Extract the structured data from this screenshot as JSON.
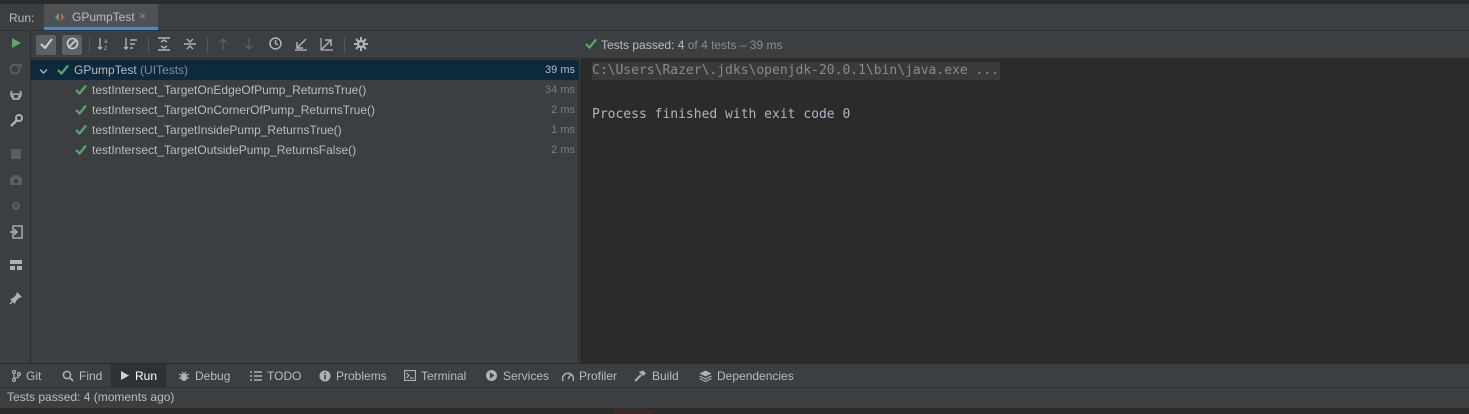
{
  "run_panel": {
    "label": "Run:",
    "tab_title": "GPumpTest",
    "tab_close": "×"
  },
  "status": {
    "prefix": "Tests passed:",
    "passed": "4",
    "suffix": "of 4 tests – 39 ms"
  },
  "tree": {
    "root": {
      "name": "GPumpTest",
      "suite": "(UITests)",
      "duration": "39 ms"
    },
    "tests": [
      {
        "name": "testIntersect_TargetOnEdgeOfPump_ReturnsTrue()",
        "duration": "34 ms"
      },
      {
        "name": "testIntersect_TargetOnCornerOfPump_ReturnsTrue()",
        "duration": "2 ms"
      },
      {
        "name": "testIntersect_TargetInsidePump_ReturnsTrue()",
        "duration": "1 ms"
      },
      {
        "name": "testIntersect_TargetOutsidePump_ReturnsFalse()",
        "duration": "2 ms"
      }
    ]
  },
  "console": {
    "command": "C:\\Users\\Razer\\.jdks\\openjdk-20.0.1\\bin\\java.exe ...",
    "output": "Process finished with exit code 0"
  },
  "bottom_tabs": [
    {
      "label": "Git",
      "icon": "git-branch-icon"
    },
    {
      "label": "Find",
      "icon": "search-icon"
    },
    {
      "label": "Run",
      "icon": "play-icon"
    },
    {
      "label": "Debug",
      "icon": "bug-icon"
    },
    {
      "label": "TODO",
      "icon": "list-icon"
    },
    {
      "label": "Problems",
      "icon": "info-icon"
    },
    {
      "label": "Terminal",
      "icon": "terminal-icon"
    },
    {
      "label": "Services",
      "icon": "services-icon"
    },
    {
      "label": "Profiler",
      "icon": "profiler-icon"
    },
    {
      "label": "Build",
      "icon": "hammer-icon"
    },
    {
      "label": "Dependencies",
      "icon": "layers-icon"
    }
  ],
  "statusbar": {
    "text": "Tests passed: 4 (moments ago)"
  },
  "colors": {
    "background": "#3c3f41",
    "console_background": "#2b2b2b",
    "selection": "#0d293e",
    "pass_green": "#59a869",
    "accent_blue": "#4a88c7"
  }
}
